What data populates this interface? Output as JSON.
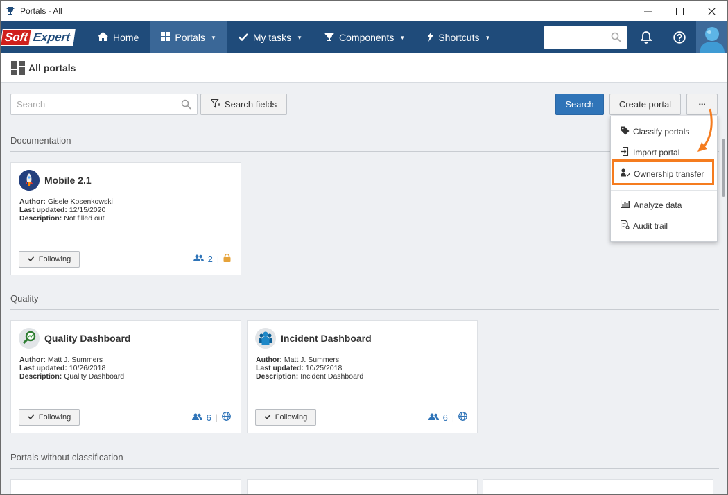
{
  "window": {
    "title": "Portals - All"
  },
  "navbar": {
    "logo_soft": "Soft",
    "logo_expert": "Expert",
    "items": [
      {
        "label": "Home"
      },
      {
        "label": "Portals"
      },
      {
        "label": "My tasks"
      },
      {
        "label": "Components"
      },
      {
        "label": "Shortcuts"
      }
    ]
  },
  "page": {
    "title": "All portals"
  },
  "toolbar": {
    "search_placeholder": "Search",
    "search_fields_label": "Search fields",
    "search_button": "Search",
    "create_portal": "Create portal",
    "more_label": "···"
  },
  "menu": {
    "items": [
      {
        "label": "Classify portals",
        "icon": "tag-icon"
      },
      {
        "label": "Import portal",
        "icon": "import-icon"
      },
      {
        "label": "Ownership transfer",
        "icon": "user-transfer-icon"
      },
      {
        "label": "Analyze data",
        "icon": "bar-chart-icon"
      },
      {
        "label": "Audit trail",
        "icon": "audit-icon"
      }
    ]
  },
  "sections": [
    {
      "title": "Documentation",
      "cards": [
        {
          "title": "Mobile 2.1",
          "author": "Gisele Kosenkowski",
          "updated": "12/15/2020",
          "description": "Not filled out",
          "follow": "Following",
          "members": "2",
          "access": "lock-icon"
        }
      ]
    },
    {
      "title": "Quality",
      "cards": [
        {
          "title": "Quality Dashboard",
          "author": "Matt J. Summers",
          "updated": "10/26/2018",
          "description": "Quality Dashboard",
          "follow": "Following",
          "members": "6",
          "access": "globe-icon"
        },
        {
          "title": "Incident Dashboard",
          "author": "Matt J. Summers",
          "updated": "10/25/2018",
          "description": "Incident Dashboard",
          "follow": "Following",
          "members": "6",
          "access": "globe-icon"
        }
      ]
    },
    {
      "title": "Portals without classification",
      "cards": []
    }
  ],
  "labels": {
    "author": "Author:",
    "updated": "Last updated:",
    "description": "Description:"
  },
  "colors": {
    "nav": "#1f4b7a",
    "primary": "#2f74b8",
    "highlight": "#f57c1f"
  }
}
